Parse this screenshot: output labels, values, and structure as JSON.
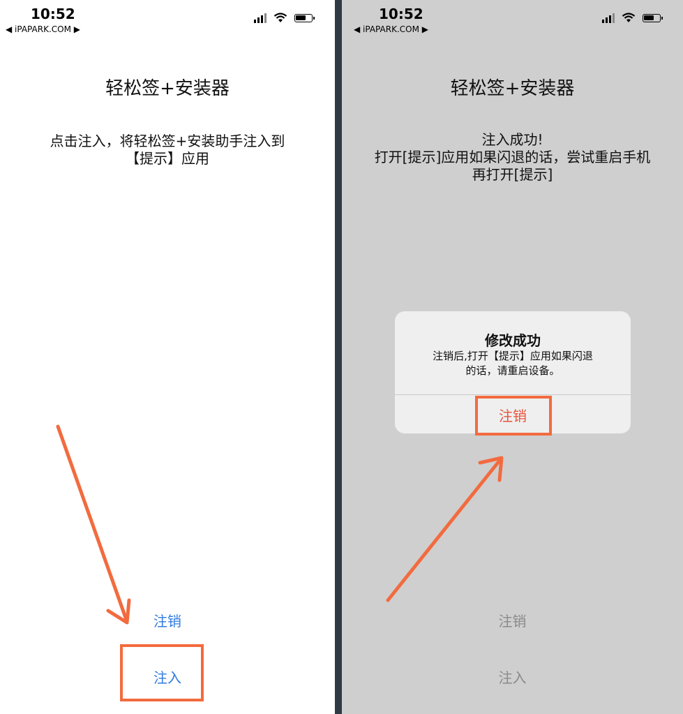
{
  "status_bar": {
    "time": "10:52",
    "back_label": "◀ iPAPARK.COM ▶"
  },
  "left_screen": {
    "title": "轻松签+安装器",
    "description_lines": [
      "点击注入，将轻松签+安装助手注入到",
      "【提示】应用"
    ],
    "cancel_button": "注销",
    "inject_button": "注入"
  },
  "right_screen": {
    "title": "轻松签+安装器",
    "description_lines": [
      "注入成功!",
      "打开[提示]应用如果闪退的话，尝试重启手机",
      "再打开[提示]"
    ],
    "cancel_button": "注销",
    "inject_button": "注入",
    "alert": {
      "title": "修改成功",
      "message_lines": [
        "注销后,打开【提示】应用如果闪退",
        "的话，请重启设备。"
      ],
      "button": "注销"
    }
  },
  "colors": {
    "accent_blue": "#2f7be0",
    "annotation_orange": "#f26b3f",
    "alert_button_red": "#e8533b"
  },
  "icons": [
    "signal-icon",
    "wifi-icon",
    "battery-icon",
    "arrow-annotation"
  ]
}
